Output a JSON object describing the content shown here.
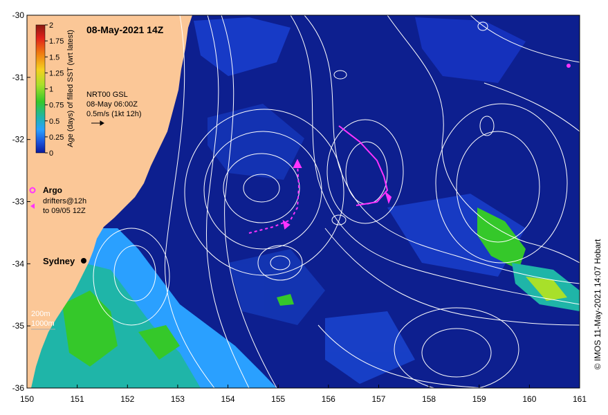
{
  "title": "08-May-2021 14Z",
  "colorbar": {
    "ticks": [
      "2",
      "1.75",
      "1.5",
      "1.25",
      "1",
      "0.75",
      "0.5",
      "0.25",
      "0"
    ],
    "label": "Age (days) of filled SST (wrt latest)",
    "colors_top_to_bottom": [
      "#8b1a10",
      "#e0201a",
      "#f07a10",
      "#f5d020",
      "#a8e02a",
      "#35c82a",
      "#1fb5a8",
      "#2aa0ff",
      "#1a4fd8",
      "#0a1a9c"
    ]
  },
  "velocity_note": {
    "line1": "NRT00 GSL",
    "line2": "08-May 06:00Z",
    "line3": "0.5m/s (1kt 12h)"
  },
  "legend": {
    "argo": "Argo",
    "drifters_line1": "drifters@12h",
    "drifters_line2": "to 09/05 12Z",
    "marker_color": "#ff33ff"
  },
  "place_label": "Sydney",
  "isobaths": [
    "200m",
    "1000m"
  ],
  "credit": "© IMOS 11-May-2021 14:07 Hobart",
  "axes": {
    "x_ticks": [
      "150",
      "151",
      "152",
      "153",
      "154",
      "155",
      "156",
      "157",
      "158",
      "159",
      "160",
      "161"
    ],
    "y_ticks": [
      "-30",
      "-31",
      "-32",
      "-33",
      "-34",
      "-35",
      "-36"
    ],
    "lon_range": [
      150,
      161
    ],
    "lat_range": [
      -36,
      -30
    ]
  },
  "colors": {
    "land": "#fbc797",
    "ocean": "#0d1f8f",
    "contour": "#ffffff"
  }
}
